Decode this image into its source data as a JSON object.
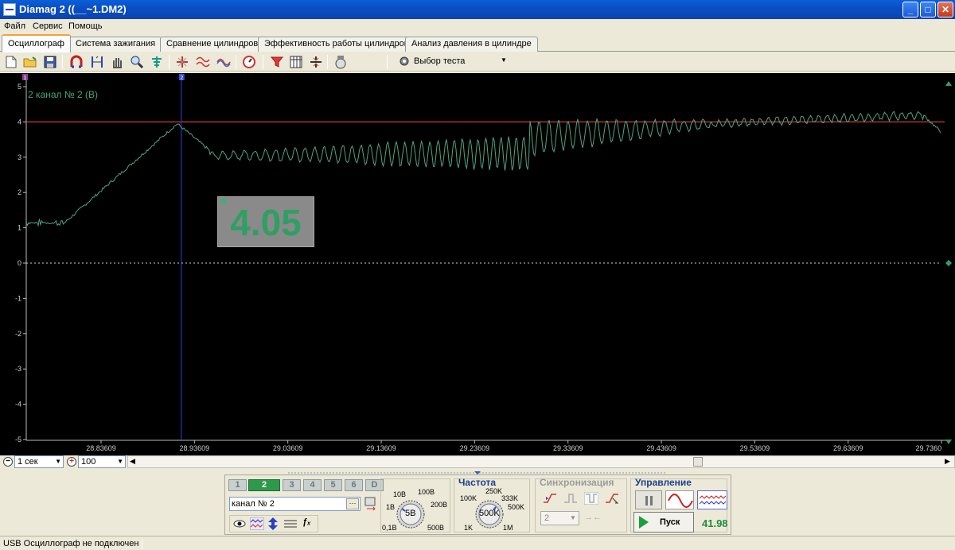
{
  "window": {
    "title": "Diamag 2 ((__~1.DM2)",
    "minimize": "_",
    "maximize": "□",
    "close": "✕"
  },
  "menu": [
    {
      "label": "Файл"
    },
    {
      "label": "Сервис"
    },
    {
      "label": "Помощь"
    }
  ],
  "tabs": [
    {
      "label": "Осциллограф",
      "active": true
    },
    {
      "label": "Система зажигания"
    },
    {
      "label": "Сравнение цилиндров"
    },
    {
      "label": "Эффективность работы цилиндров"
    },
    {
      "label": "Анализ давления в цилиндре"
    }
  ],
  "toolbar": {
    "tools": [
      "new-file-icon",
      "open-folder-icon",
      "save-disk-icon",
      "magnet-icon",
      "cursor-measure-icon",
      "hand-pan-icon",
      "zoom-icon",
      "tree-signal-icon",
      "crosshair-icon",
      "wave-compare-icon",
      "wave-overlay-icon",
      "auto-scale-icon",
      "filter-icon",
      "grid-icon",
      "split-icon",
      "auto-icon"
    ],
    "test_select": {
      "label": "Выбор теста",
      "icon": "gear-icon"
    }
  },
  "scope": {
    "channel_label": "2 канал № 2 (В)",
    "y_ticks": [
      "5",
      "4",
      "3",
      "2",
      "1",
      "0",
      "-1",
      "-2",
      "-3",
      "-4",
      "-5"
    ],
    "x_ticks": [
      "28.83609",
      "28.93609",
      "29.03609",
      "29.13609",
      "29.23609",
      "29.33609",
      "29.43609",
      "29.53609",
      "29.63609",
      "29.7360"
    ],
    "y_range": [
      -5,
      5
    ],
    "x_range": [
      28.756,
      29.736
    ],
    "threshold_level": 4.0,
    "cursor_time": 28.922,
    "markers": [
      "1",
      "2"
    ],
    "value_readout": "4.05",
    "trace_color": "#4fa383",
    "threshold_color": "#d23a3a",
    "cursor_color": "#2b44d8"
  },
  "controls": {
    "time_scale": "1 сек",
    "point_count": "100",
    "channel_buttons": [
      "1",
      "2",
      "3",
      "4",
      "5",
      "6",
      "D"
    ],
    "active_channel": "2",
    "channel_field": "канал № 2",
    "voltage_labels": {
      "v10": "10В",
      "v100": "100В",
      "v1": "1В",
      "v200": "200В",
      "v01": "0,1В",
      "v500": "500В",
      "current": "5В"
    },
    "frequency": {
      "title": "Частота",
      "f250": "250K",
      "f100": "100K",
      "f333": "333K",
      "f500": "500K",
      "f1": "1K",
      "f1m": "1M",
      "current": "500K"
    },
    "sync": {
      "title": "Синхронизация",
      "channel": "2"
    },
    "control": {
      "title": "Управление",
      "start": "Пуск",
      "elapsed": "41.98"
    }
  },
  "status": {
    "text": "USB Осциллограф не подключен"
  }
}
